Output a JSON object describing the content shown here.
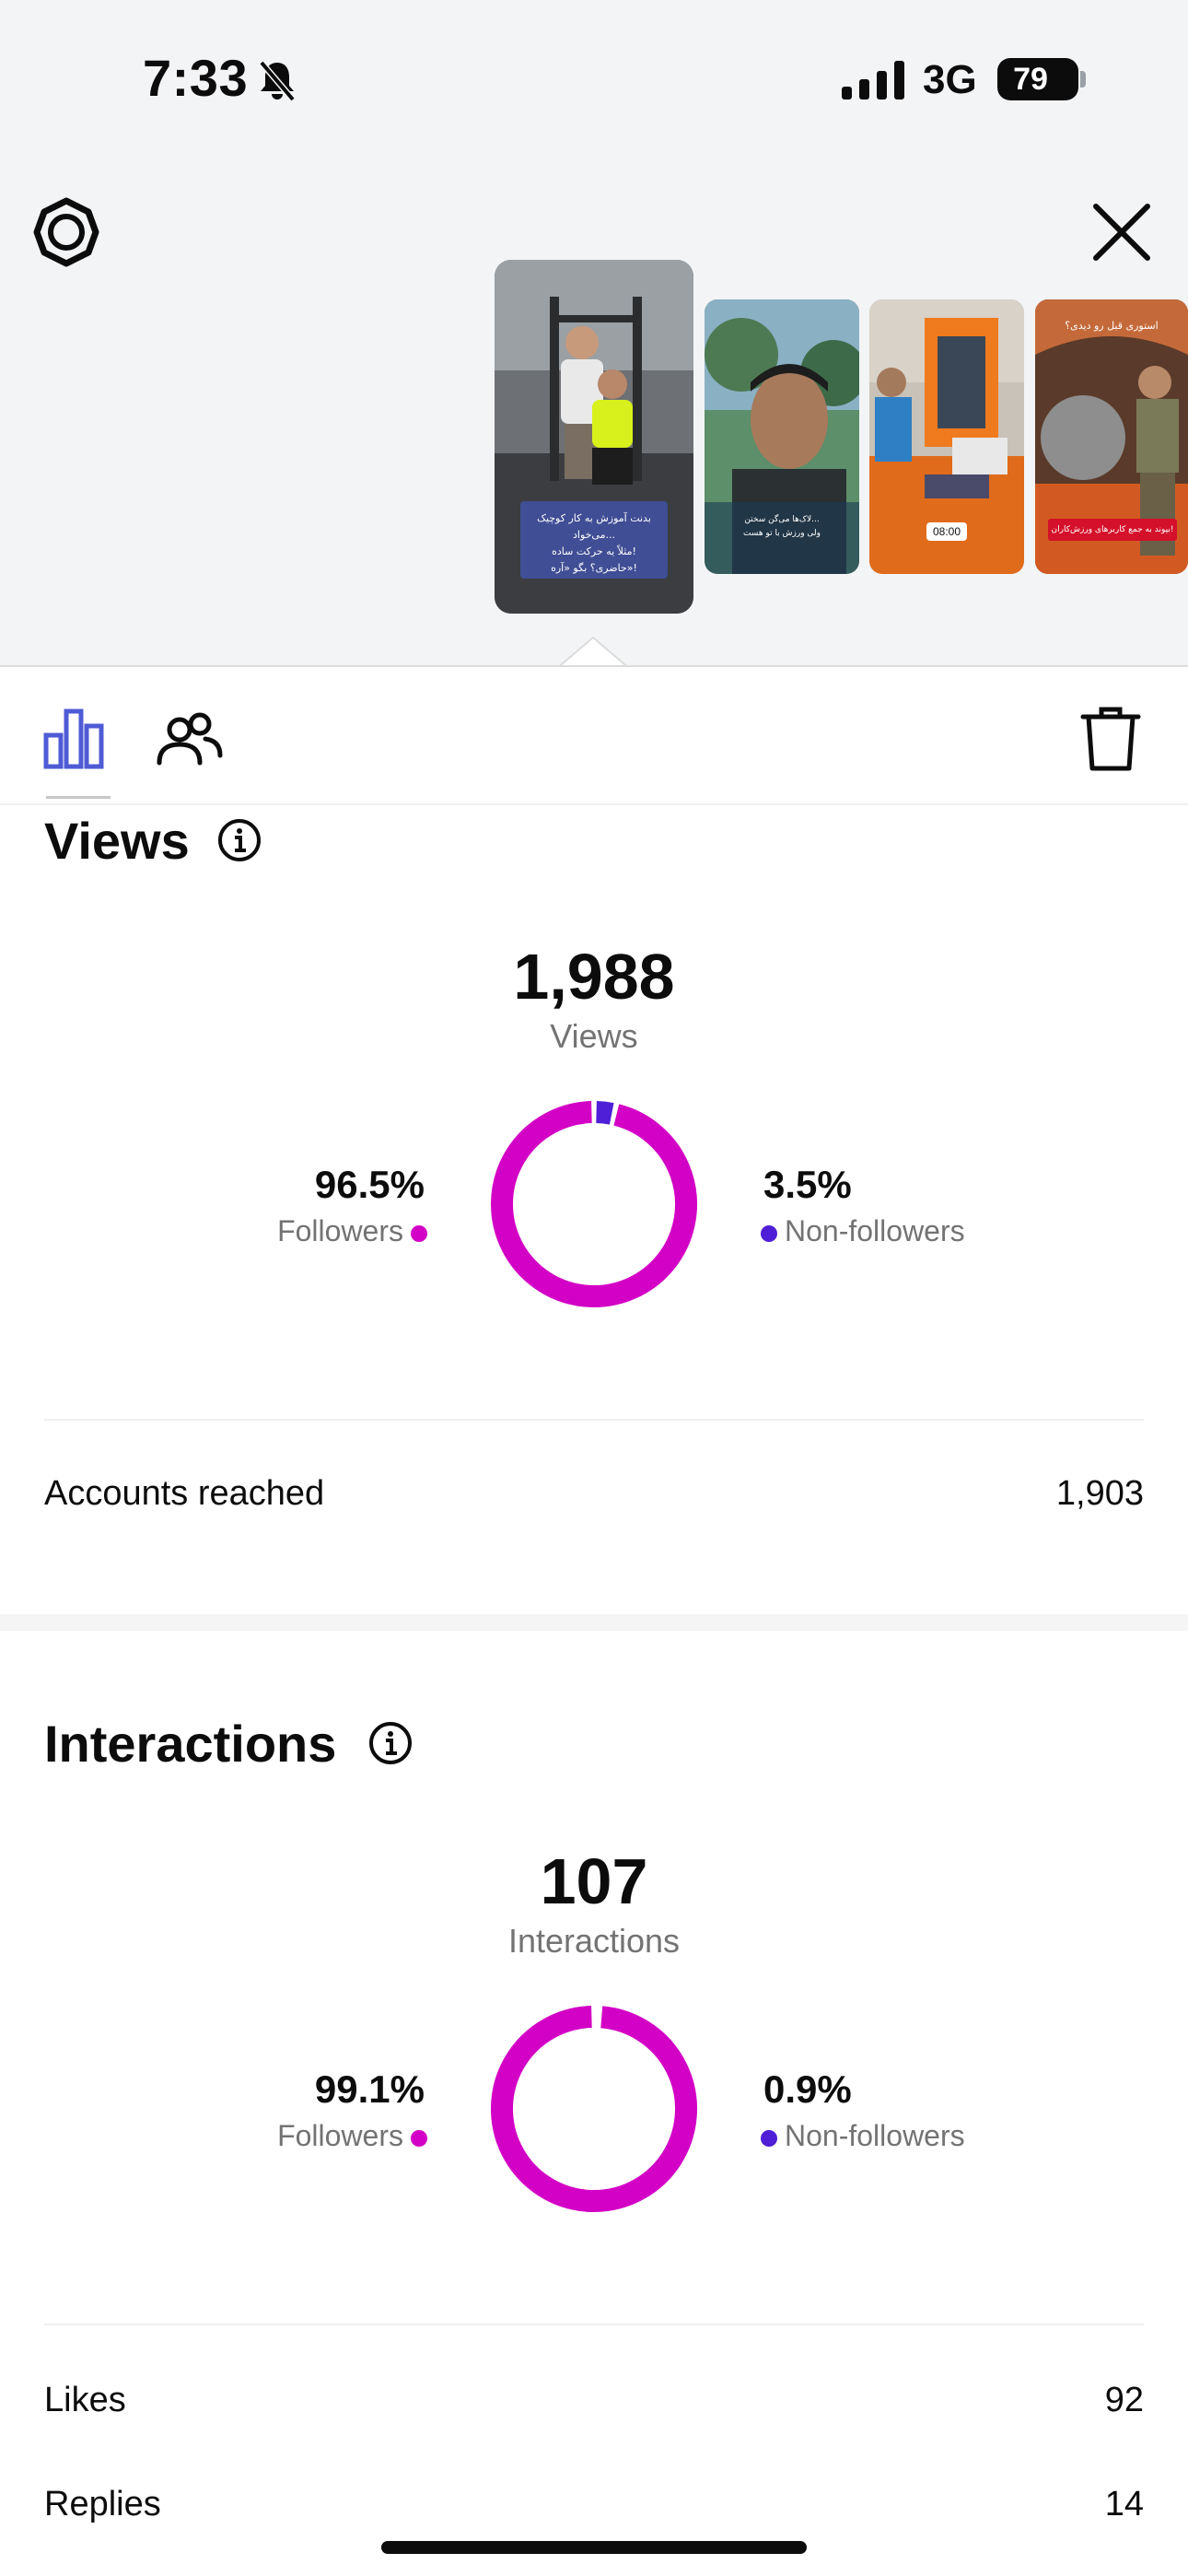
{
  "status_bar": {
    "time": "7:33",
    "network": "3G",
    "battery": "79",
    "icons": [
      "bell-muted-icon",
      "signal-icon",
      "battery-icon"
    ]
  },
  "header": {
    "icons": [
      "settings-icon",
      "close-icon"
    ]
  },
  "story_thumbnails": [
    {
      "text_lines": [
        "بدنت آموزش به کار کوچیک می‌خواد...",
        "مثلاً یه حرکت ساده!",
        "حاضری؟ بگو «آره»!"
      ],
      "selected": true
    },
    {
      "text_lines": [
        "لاک‌ها می‌گن سختن...",
        "ولی ورزش با تو هست"
      ],
      "selected": false
    },
    {
      "text_lines": [
        "08:00"
      ],
      "selected": false
    },
    {
      "text_lines": [
        "استوری قبل رو دیدی؟",
        "بپوند به جمع کاربرهای ورزش‌کاران!"
      ],
      "selected": false
    }
  ],
  "tabs": {
    "icons": [
      "insights-chart-icon",
      "audience-people-icon",
      "trash-icon"
    ]
  },
  "views": {
    "title": "Views",
    "total": "1,988",
    "total_label": "Views",
    "followers_pct": "96.5%",
    "followers_label": "Followers",
    "non_followers_pct": "3.5%",
    "non_followers_label": "Non-followers",
    "followers_fraction": 0.965,
    "non_followers_fraction": 0.035
  },
  "accounts_reached": {
    "label": "Accounts reached",
    "value": "1,903"
  },
  "interactions": {
    "title": "Interactions",
    "total": "107",
    "total_label": "Interactions",
    "followers_pct": "99.1%",
    "followers_label": "Followers",
    "non_followers_pct": "0.9%",
    "non_followers_label": "Non-followers",
    "followers_fraction": 0.991,
    "non_followers_fraction": 0.009
  },
  "metrics": [
    {
      "label": "Likes",
      "value": "92"
    },
    {
      "label": "Replies",
      "value": "14"
    }
  ],
  "colors": {
    "followers": "#d300c5",
    "non_followers": "#4f1fd7",
    "active_tab": "#4f5bd5"
  }
}
